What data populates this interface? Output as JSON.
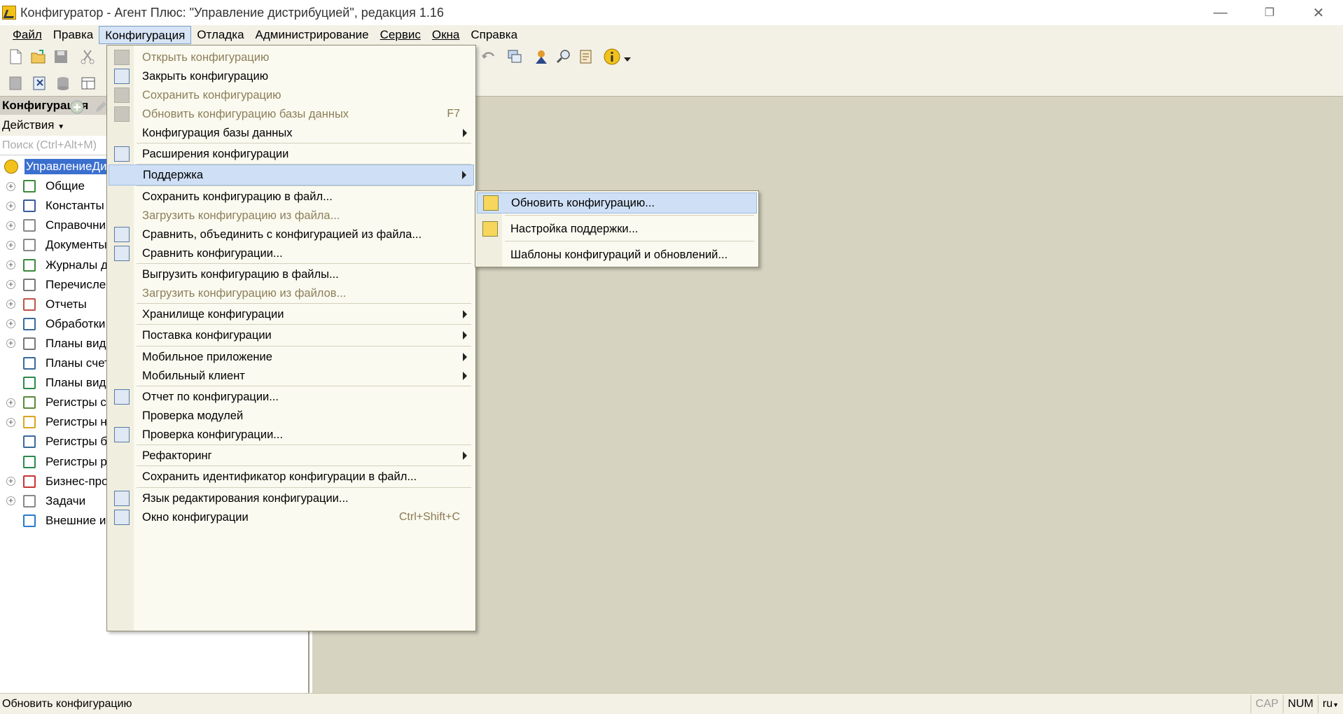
{
  "window": {
    "title": "Конфигуратор - Агент Плюс: \"Управление дистрибуцией\", редакция 1.16",
    "minimize": "—",
    "restore": "❐",
    "close": "✕"
  },
  "menubar": {
    "items": [
      "Файл",
      "Правка",
      "Конфигурация",
      "Отладка",
      "Администрирование",
      "Сервис",
      "Окна",
      "Справка"
    ]
  },
  "left_panel": {
    "header": "Конфигурация",
    "actions_label": "Действия",
    "search_placeholder": "Поиск (Ctrl+Alt+M)",
    "tree": [
      {
        "label": "УправлениеДи",
        "icon": "config-root-icon"
      },
      {
        "label": "Общие",
        "icon": "common-icon"
      },
      {
        "label": "Константы",
        "icon": "constants-icon"
      },
      {
        "label": "Справочни",
        "icon": "catalogs-icon"
      },
      {
        "label": "Документы",
        "icon": "documents-icon"
      },
      {
        "label": "Журналы до",
        "icon": "journals-icon"
      },
      {
        "label": "Перечисле",
        "icon": "enums-icon"
      },
      {
        "label": "Отчеты",
        "icon": "reports-icon"
      },
      {
        "label": "Обработки",
        "icon": "dataprocessors-icon"
      },
      {
        "label": "Планы видо",
        "icon": "chart-types-icon"
      },
      {
        "label": "Планы счет",
        "icon": "chart-accounts-icon"
      },
      {
        "label": "Планы видо",
        "icon": "calc-types-icon"
      },
      {
        "label": "Регистры св",
        "icon": "info-registers-icon"
      },
      {
        "label": "Регистры на",
        "icon": "accum-registers-icon"
      },
      {
        "label": "Регистры бу",
        "icon": "accounting-registers-icon"
      },
      {
        "label": "Регистры ра",
        "icon": "calc-registers-icon"
      },
      {
        "label": "Бизнес-про",
        "icon": "business-processes-icon"
      },
      {
        "label": "Задачи",
        "icon": "tasks-icon"
      },
      {
        "label": "Внешние ис",
        "icon": "external-sources-icon"
      }
    ]
  },
  "config_menu": {
    "items": [
      {
        "label": "Открыть конфигурацию",
        "disabled": true
      },
      {
        "label": "Закрыть конфигурацию",
        "disabled": false
      },
      {
        "label": "Сохранить конфигурацию",
        "disabled": true
      },
      {
        "label": "Обновить конфигурацию базы данных",
        "disabled": true,
        "shortcut": "F7"
      },
      {
        "label": "Конфигурация базы данных",
        "submenu": true
      },
      {
        "label": "Расширения конфигурации"
      },
      {
        "label": "Поддержка",
        "submenu": true,
        "highlight": true
      },
      {
        "label": "Сохранить конфигурацию в файл..."
      },
      {
        "label": "Загрузить конфигурацию из файла...",
        "disabled": true
      },
      {
        "label": "Сравнить, объединить с конфигурацией из файла..."
      },
      {
        "label": "Сравнить конфигурации..."
      },
      {
        "label": "Выгрузить конфигурацию в файлы..."
      },
      {
        "label": "Загрузить конфигурацию из файлов...",
        "disabled": true
      },
      {
        "label": "Хранилище конфигурации",
        "submenu": true
      },
      {
        "label": "Поставка конфигурации",
        "submenu": true
      },
      {
        "label": "Мобильное приложение",
        "submenu": true
      },
      {
        "label": "Мобильный клиент",
        "submenu": true
      },
      {
        "label": "Отчет по конфигурации..."
      },
      {
        "label": "Проверка модулей"
      },
      {
        "label": "Проверка конфигурации..."
      },
      {
        "label": "Рефакторинг",
        "submenu": true
      },
      {
        "label": "Сохранить идентификатор конфигурации в файл..."
      },
      {
        "label": "Язык редактирования конфигурации..."
      },
      {
        "label": "Окно конфигурации",
        "shortcut": "Ctrl+Shift+C"
      }
    ]
  },
  "support_submenu": {
    "items": [
      {
        "label": "Обновить конфигурацию...",
        "highlight": true
      },
      {
        "label": "Настройка поддержки..."
      },
      {
        "label": "Шаблоны конфигураций и обновлений..."
      }
    ]
  },
  "statusbar": {
    "text": "Обновить конфигурацию",
    "cap": "CAP",
    "num": "NUM",
    "lang": "ru"
  }
}
